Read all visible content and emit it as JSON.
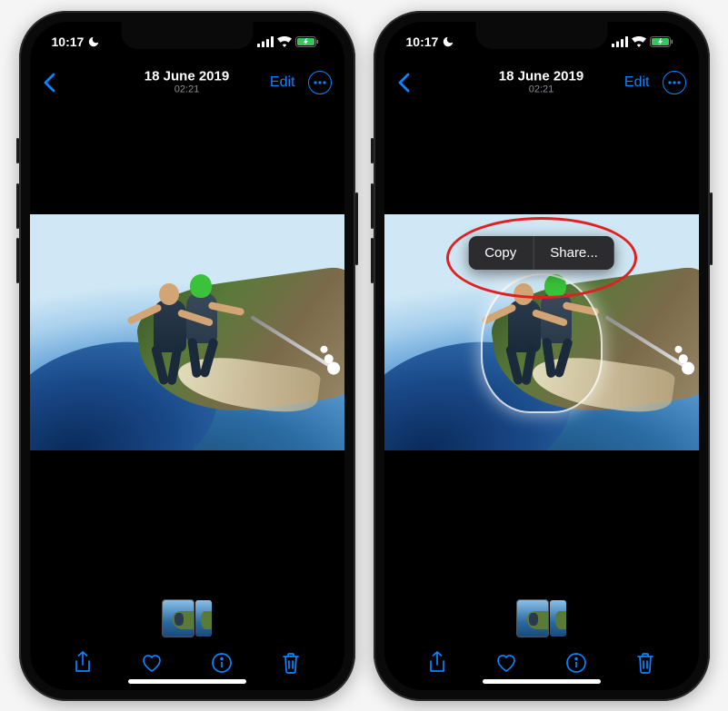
{
  "status_bar": {
    "time": "10:17",
    "dnd_icon": "moon-icon",
    "signal_icon": "cellular-signal-icon",
    "wifi_icon": "wifi-icon",
    "battery_icon": "battery-charging-icon"
  },
  "nav": {
    "back_icon": "chevron-left-icon",
    "date": "18 June 2019",
    "time": "02:21",
    "edit_label": "Edit",
    "more_icon": "ellipsis-icon"
  },
  "context_menu": {
    "copy_label": "Copy",
    "share_label": "Share..."
  },
  "toolbar": {
    "share_icon": "share-icon",
    "favorite_icon": "heart-icon",
    "info_icon": "info-icon",
    "trash_icon": "trash-icon"
  },
  "colors": {
    "accent": "#0a84ff",
    "annotation": "#e02020",
    "menu_bg": "#2c2c2e"
  },
  "screens": [
    {
      "id": "left",
      "has_context_menu": false,
      "has_subject_glow": false,
      "has_annotation": false
    },
    {
      "id": "right",
      "has_context_menu": true,
      "has_subject_glow": true,
      "has_annotation": true
    }
  ]
}
